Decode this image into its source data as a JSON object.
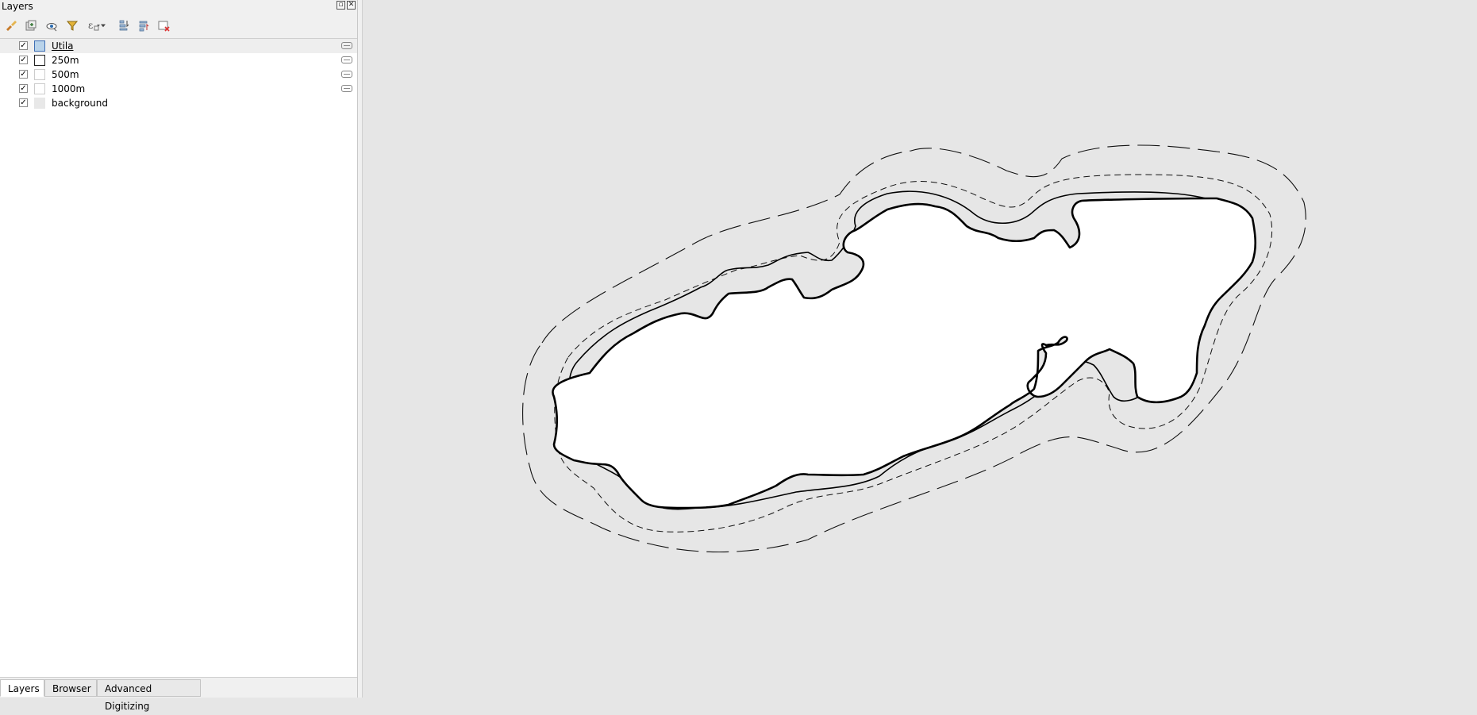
{
  "dock": {
    "title": "Layers",
    "float_icon": "restore-icon",
    "close_icon": "close-icon"
  },
  "toolbar": [
    {
      "name": "style-manager-icon"
    },
    {
      "name": "add-group-icon"
    },
    {
      "name": "visibility-icon"
    },
    {
      "name": "filter-legend-icon"
    },
    {
      "name": "filter-expression-icon"
    },
    {
      "name": "expand-all-icon"
    },
    {
      "name": "collapse-all-icon"
    },
    {
      "name": "remove-layer-icon"
    }
  ],
  "layers": [
    {
      "label": "Utila",
      "checked": true,
      "symbol_fill": "#b9d3ea",
      "symbol_stroke": "#3f6fb5",
      "selected": true
    },
    {
      "label": "250m",
      "checked": true,
      "symbol_fill": "#ffffff",
      "symbol_stroke": "#222222",
      "selected": false
    },
    {
      "label": "500m",
      "checked": true,
      "symbol_fill": "#ffffff",
      "symbol_stroke": "#cccccc",
      "selected": false
    },
    {
      "label": "1000m",
      "checked": true,
      "symbol_fill": "#ffffff",
      "symbol_stroke": "#cccccc",
      "selected": false
    },
    {
      "label": "background",
      "checked": true,
      "symbol_fill": "#e8e8e8",
      "symbol_stroke": "#e8e8e8",
      "selected": false
    }
  ],
  "tabs": [
    {
      "label": "Layers",
      "active": true
    },
    {
      "label": "Browser",
      "active": false
    },
    {
      "label": "Advanced Digitizing",
      "active": false
    }
  ],
  "colors": {
    "canvas_background": "#e6e6e6",
    "island_fill": "#ffffff",
    "outline": "#000000"
  }
}
